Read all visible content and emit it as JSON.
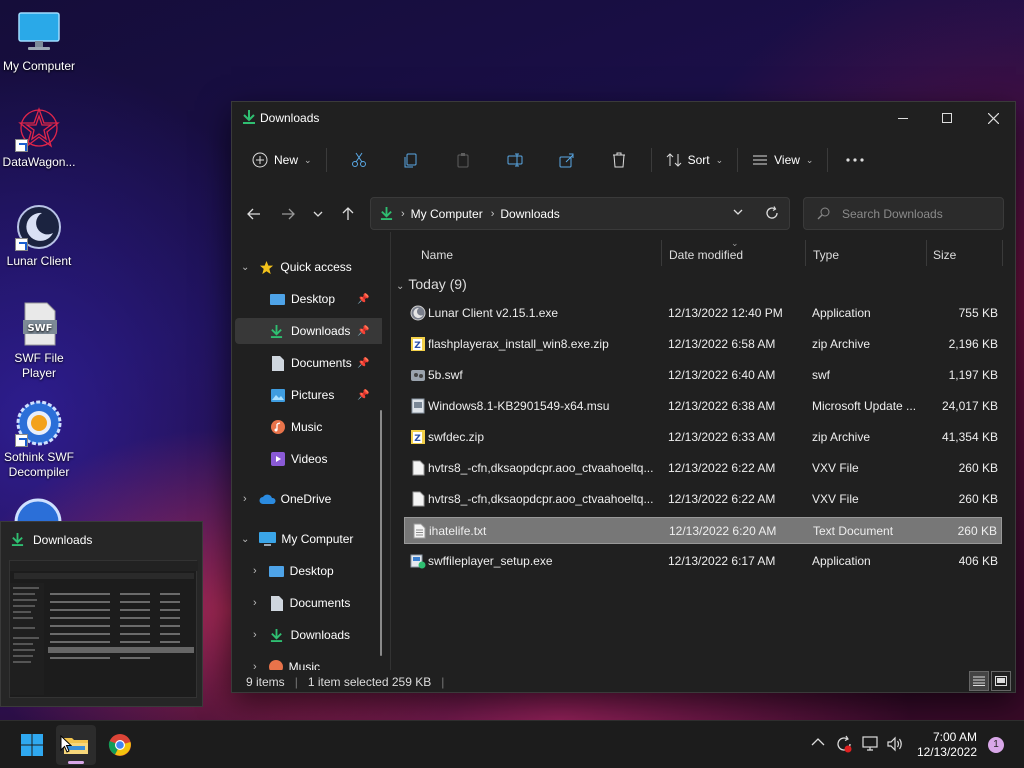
{
  "desktop": {
    "icons": [
      {
        "label": "My Computer"
      },
      {
        "label": "DataWagon..."
      },
      {
        "label": "Lunar Client"
      },
      {
        "label": "SWF File Player"
      },
      {
        "label": "Sothink SWF Decompiler"
      }
    ]
  },
  "window": {
    "title": "Downloads",
    "toolbar": {
      "new_label": "New",
      "sort_label": "Sort",
      "view_label": "View"
    },
    "address": {
      "crumbs": [
        "My Computer",
        "Downloads"
      ]
    },
    "search": {
      "placeholder": "Search Downloads"
    },
    "sidebar": {
      "items": [
        {
          "label": "Quick access"
        },
        {
          "label": "Desktop"
        },
        {
          "label": "Downloads"
        },
        {
          "label": "Documents"
        },
        {
          "label": "Pictures"
        },
        {
          "label": "Music"
        },
        {
          "label": "Videos"
        },
        {
          "label": "OneDrive"
        },
        {
          "label": "My Computer"
        },
        {
          "label": "Desktop"
        },
        {
          "label": "Documents"
        },
        {
          "label": "Downloads"
        },
        {
          "label": "Music"
        }
      ]
    },
    "columns": {
      "name": "Name",
      "date": "Date modified",
      "type": "Type",
      "size": "Size"
    },
    "group_label": "Today (9)",
    "files": [
      {
        "name": "Lunar Client v2.15.1.exe",
        "date": "12/13/2022 12:40 PM",
        "type": "Application",
        "size": "755 KB",
        "icon": "lunar-app-icon"
      },
      {
        "name": "flashplayerax_install_win8.exe.zip",
        "date": "12/13/2022 6:58 AM",
        "type": "zip Archive",
        "size": "2,196 KB",
        "icon": "zip-icon"
      },
      {
        "name": "5b.swf",
        "date": "12/13/2022 6:40 AM",
        "type": "swf",
        "size": "1,197 KB",
        "icon": "swf-file-icon"
      },
      {
        "name": "Windows8.1-KB2901549-x64.msu",
        "date": "12/13/2022 6:38 AM",
        "type": "Microsoft Update ...",
        "size": "24,017 KB",
        "icon": "msu-icon"
      },
      {
        "name": "swfdec.zip",
        "date": "12/13/2022 6:33 AM",
        "type": "zip Archive",
        "size": "41,354 KB",
        "icon": "zip-icon"
      },
      {
        "name": "hvtrs8_-cfn,dksaopdcpr.aoo_ctvaahoeltq...",
        "date": "12/13/2022 6:22 AM",
        "type": "VXV File",
        "size": "260 KB",
        "icon": "blank-file-icon"
      },
      {
        "name": "hvtrs8_-cfn,dksaopdcpr.aoo_ctvaahoeltq...",
        "date": "12/13/2022 6:22 AM",
        "type": "VXV File",
        "size": "260 KB",
        "icon": "blank-file-icon"
      },
      {
        "name": "ihatelife.txt",
        "date": "12/13/2022 6:20 AM",
        "type": "Text Document",
        "size": "260 KB",
        "icon": "text-file-icon",
        "selected": true
      },
      {
        "name": "swffileplayer_setup.exe",
        "date": "12/13/2022 6:17 AM",
        "type": "Application",
        "size": "406 KB",
        "icon": "installer-icon"
      }
    ],
    "status": {
      "count": "9 items",
      "selection": "1 item selected  259 KB"
    }
  },
  "thumbnail": {
    "title": "Downloads"
  },
  "taskbar": {
    "time": "7:00 AM",
    "date": "12/13/2022",
    "notification_count": "1"
  },
  "colors": {
    "accent_green": "#2fbf71",
    "selection_gray": "#777777",
    "window_bg": "#202020"
  }
}
